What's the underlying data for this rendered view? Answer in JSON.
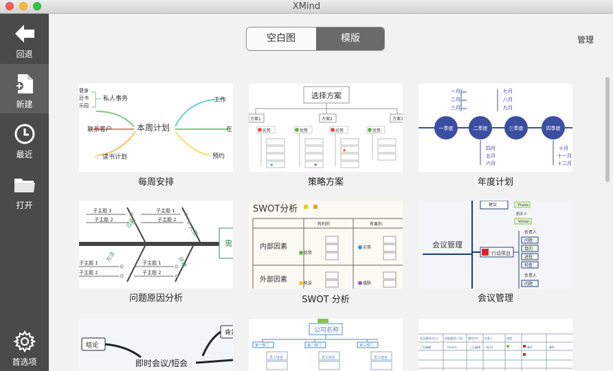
{
  "window": {
    "title": "XMind"
  },
  "sidebar": {
    "items": [
      {
        "label": "回退",
        "icon": "back-arrow-icon"
      },
      {
        "label": "新建",
        "icon": "new-file-icon"
      },
      {
        "label": "最近",
        "icon": "clock-icon"
      },
      {
        "label": "打开",
        "icon": "folder-icon"
      },
      {
        "label": "首选项",
        "icon": "gear-icon"
      }
    ]
  },
  "tabs": {
    "blank": "空白图",
    "templates": "模版"
  },
  "manage_label": "管理",
  "templates": [
    {
      "name": "每周安排"
    },
    {
      "name": "策略方案"
    },
    {
      "name": "年度计划"
    },
    {
      "name": "问题原因分析"
    },
    {
      "name": "SWOT 分析"
    },
    {
      "name": "会议管理"
    }
  ],
  "thumb1": {
    "center": "本周计划",
    "n1": "私人事务",
    "n2": "联系客户",
    "n3": "读书计划",
    "n4": "工作",
    "n5": "在",
    "n6": "预约",
    "l1": "健身",
    "l2": "还书",
    "l3": "乐园"
  },
  "thumb2": {
    "root": "选择方案",
    "p1": "方案1",
    "p2": "方案2",
    "p3": "方案3",
    "lab": "劣势",
    "lab2": "优势",
    "sub": "子主题"
  },
  "thumb3": {
    "q1": "一季度",
    "q2": "二季度",
    "q3": "三季度",
    "q4": "四季度",
    "m": [
      "一月",
      "二月",
      "三月",
      "四月",
      "五月",
      "六月",
      "七月",
      "八月",
      "九月",
      "十月",
      "十一月",
      "十二月"
    ]
  },
  "thumb4": {
    "s1": "子主题 1",
    "s2": "子主题 2",
    "b1": "过程",
    "b2": "人员",
    "b3": "方法",
    "b4": "环境",
    "head": "需"
  },
  "thumb5": {
    "title": "SWOT分析",
    "h1": "有利的",
    "h2": "有害的",
    "r1": "内部因素",
    "r2": "外部因素",
    "c1": "优势",
    "c2": "劣势",
    "c3": "机会",
    "c4": "威胁"
  },
  "thumb6": {
    "center": "会议管理",
    "act": "行动项目",
    "idea": "建议",
    "i1": "Praxis",
    "i2": "Vitrian",
    "t3": "想法 3",
    "r": [
      "负责人",
      "问题",
      "目的",
      "进程",
      "检查",
      "负责人",
      "问题"
    ]
  },
  "thumb7": {
    "center": "即时会议/短会",
    "n1": "结论",
    "n2": "背景"
  },
  "thumb8": {
    "root": "公司名称",
    "d1": "第一部门",
    "d2": "第二部门",
    "d3": "第三部门",
    "e": "员工姓名"
  },
  "thumb9": {
    "h": [
      "会议事项(办公)",
      "进展事项(人员)",
      "事件(中)",
      "负责人",
      "进度"
    ],
    "v": [
      "三五编辑",
      "Foxmit",
      "项目1",
      "事件"
    ]
  }
}
